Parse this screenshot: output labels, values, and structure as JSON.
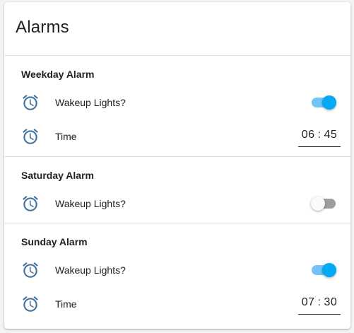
{
  "card": {
    "title": "Alarms"
  },
  "sections": [
    {
      "title": "Weekday Alarm",
      "wakeup_label": "Wakeup Lights?",
      "wakeup_on": true,
      "time_label": "Time",
      "time_hour": "06",
      "time_sep": ":",
      "time_minute": "45"
    },
    {
      "title": "Saturday Alarm",
      "wakeup_label": "Wakeup Lights?",
      "wakeup_on": false
    },
    {
      "title": "Sunday Alarm",
      "wakeup_label": "Wakeup Lights?",
      "wakeup_on": true,
      "time_label": "Time",
      "time_hour": "07",
      "time_sep": ":",
      "time_minute": "30"
    }
  ],
  "icons": {
    "row_icon": "alarm-clock-icon"
  },
  "colors": {
    "icon": "#44739e",
    "toggle_on_thumb": "#03a9f4",
    "toggle_on_track": "#72c4f6",
    "toggle_off_thumb": "#fafafa",
    "toggle_off_track": "#9e9e9e"
  }
}
